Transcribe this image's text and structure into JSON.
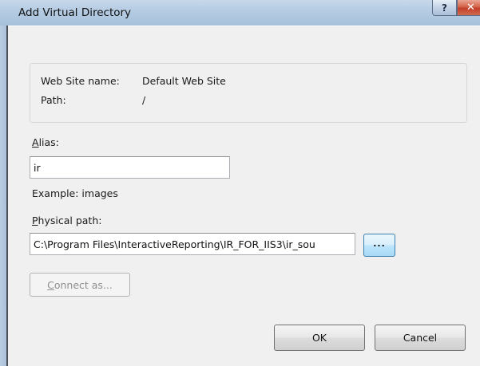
{
  "window": {
    "title": "Add Virtual Directory",
    "help_glyph": "?",
    "close_glyph": "✕"
  },
  "info": {
    "site_name_label": "Web Site name:",
    "site_name_value": "Default Web Site",
    "path_label": "Path:",
    "path_value": "/"
  },
  "alias": {
    "label_hotkey": "A",
    "label_rest": "lias:",
    "value": "ir",
    "example": "Example: images"
  },
  "physical_path": {
    "label_hotkey": "P",
    "label_rest": "hysical path:",
    "value": "C:\\Program Files\\InteractiveReporting\\IR_FOR_IIS3\\ir_sou",
    "browse_label": "..."
  },
  "connect_as": {
    "label_hotkey": "C",
    "label_rest": "onnect as...",
    "enabled": false
  },
  "buttons": {
    "ok_label": "OK",
    "cancel_label": "Cancel"
  }
}
